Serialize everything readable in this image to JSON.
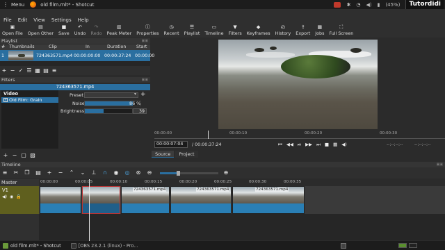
{
  "system": {
    "menu_label": "Menu",
    "window_title": "old film.mlt* - Shotcut",
    "battery": "(45%)",
    "clock": "",
    "brand": "Tutordidi"
  },
  "menubar": [
    "File",
    "Edit",
    "View",
    "Settings",
    "Help"
  ],
  "toolbar": [
    {
      "label": "Open File",
      "icon": "folder-open-icon",
      "glyph": "▣"
    },
    {
      "label": "Open Other",
      "icon": "folder-other-icon",
      "glyph": "▤"
    },
    {
      "label": "Save",
      "icon": "save-icon",
      "glyph": "■"
    },
    {
      "label": "Undo",
      "icon": "undo-icon",
      "glyph": "↶"
    },
    {
      "label": "Redo",
      "icon": "redo-icon",
      "glyph": "↷",
      "disabled": true
    },
    {
      "label": "Peak Meter",
      "icon": "peak-meter-icon",
      "glyph": "▥"
    },
    {
      "label": "Properties",
      "icon": "properties-icon",
      "glyph": "ⓘ"
    },
    {
      "label": "Recent",
      "icon": "recent-icon",
      "glyph": "◷"
    },
    {
      "label": "Playlist",
      "icon": "playlist-icon",
      "glyph": "☰"
    },
    {
      "label": "Timeline",
      "icon": "timeline-icon",
      "glyph": "▭"
    },
    {
      "label": "Filters",
      "icon": "filters-icon",
      "glyph": "▼"
    },
    {
      "label": "Keyframes",
      "icon": "keyframes-icon",
      "glyph": "◆"
    },
    {
      "label": "History",
      "icon": "history-icon",
      "glyph": "◴"
    },
    {
      "label": "Export",
      "icon": "export-icon",
      "glyph": "⇪"
    },
    {
      "label": "Jobs",
      "icon": "jobs-icon",
      "glyph": "▦"
    },
    {
      "label": "Full Screen",
      "icon": "fullscreen-icon",
      "glyph": "⛶"
    }
  ],
  "playlist": {
    "title": "Playlist",
    "columns": [
      "#",
      "Thumbnails",
      "Clip",
      "In",
      "Duration",
      "Start"
    ],
    "rows": [
      {
        "num": "1",
        "clip": "724363571.mp4",
        "in": "00:00:00:00",
        "duration": "00:00:37:24",
        "start": "00:00:00"
      }
    ]
  },
  "filters": {
    "title": "Filters",
    "clip_name": "724363571.mp4",
    "section": "Video",
    "items": [
      {
        "label": "Old Film: Grain",
        "checked": true
      }
    ],
    "preset_label": "Preset",
    "noise_label": "Noise",
    "noise_value": "86 %",
    "noise_fraction": 0.86,
    "brightness_label": "Brightness",
    "brightness_value": "39",
    "brightness_fraction": 0.39
  },
  "viewer": {
    "ruler_ticks": [
      "00:00:00",
      "00:00:10",
      "00:00:20",
      "00:00:30"
    ],
    "current_time": "00:00:07:04",
    "total_time": "/ 00:00:37:24",
    "in_point": "--:--:--:--",
    "out_point": "--:--:--:--",
    "tabs": [
      "Source",
      "Project"
    ]
  },
  "timeline": {
    "title": "Timeline",
    "master_label": "Master",
    "track_label": "V1",
    "ruler_ticks": [
      "00:00:00",
      "00:00:05",
      "00:00:10",
      "00:00:15",
      "00:00:20",
      "00:00:25",
      "00:00:30",
      "00:00:35"
    ],
    "clips": [
      "724363571.mp4",
      "724363571.mp4",
      "724363571.mp4"
    ]
  },
  "taskbar": {
    "items": [
      "old film.mlt* - Shotcut",
      "[OBS 23.2.1 (linux) - Pro..."
    ]
  },
  "colors": {
    "accent": "#2a6fa0",
    "track_header": "#5f5f1e",
    "waveform": "#2a7fb5"
  }
}
